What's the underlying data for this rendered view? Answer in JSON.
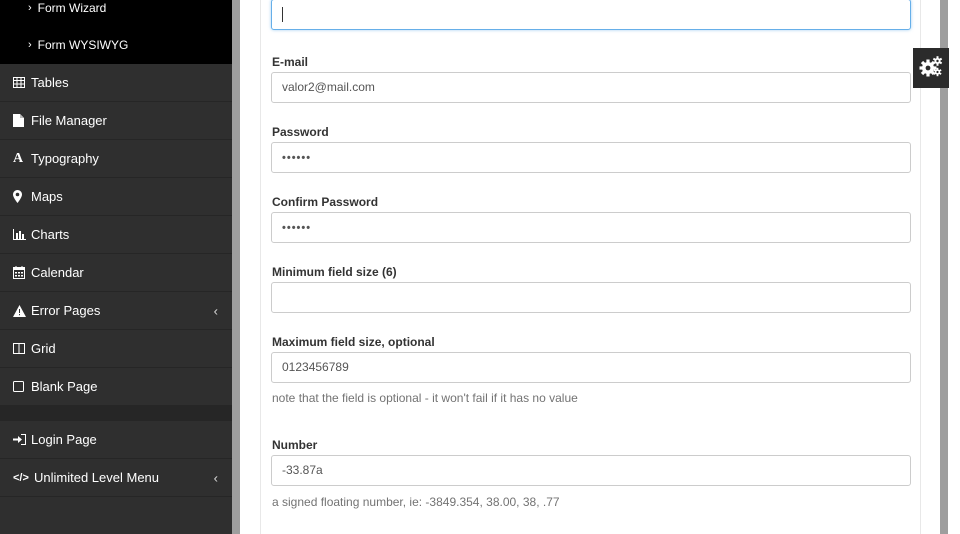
{
  "sidebar": {
    "sub_items": [
      {
        "chevron": "›",
        "label": "Form Wizard"
      },
      {
        "chevron": "›",
        "label": "Form WYSIWYG"
      }
    ],
    "items": [
      {
        "icon": "table-icon",
        "label": "Tables"
      },
      {
        "icon": "file-icon",
        "label": "File Manager"
      },
      {
        "icon": "font-icon",
        "label": "Typography"
      },
      {
        "icon": "map-marker-icon",
        "label": "Maps"
      },
      {
        "icon": "bar-chart-icon",
        "label": "Charts"
      },
      {
        "icon": "calendar-icon",
        "label": "Calendar"
      },
      {
        "icon": "warning-icon",
        "label": "Error Pages",
        "caret": "‹"
      },
      {
        "icon": "columns-icon",
        "label": "Grid"
      },
      {
        "icon": "square-icon",
        "label": "Blank Page"
      }
    ],
    "items2": [
      {
        "icon": "sign-in-icon",
        "label": "Login Page"
      },
      {
        "icon": "code-icon",
        "label": "Unlimited Level Menu",
        "caret": "‹"
      }
    ]
  },
  "form": {
    "top_field": {
      "value": ""
    },
    "email": {
      "label": "E-mail",
      "value": "valor2@mail.com"
    },
    "password": {
      "label": "Password",
      "value": "••••••"
    },
    "confirm_password": {
      "label": "Confirm Password",
      "value": "••••••"
    },
    "min_size": {
      "label": "Minimum field size (6)",
      "value": ""
    },
    "max_size": {
      "label": "Maximum field size, optional",
      "value": "0123456789",
      "help": "note that the field is optional - it won't fail if it has no value"
    },
    "number": {
      "label": "Number",
      "value": "-33.87a",
      "help": "a signed floating number, ie: -3849.354, 38.00, 38, .77"
    }
  },
  "settings": {
    "icon": "gears-icon"
  },
  "colors": {
    "sidebar_bg": "#2f2f2f",
    "submenu_bg": "#000000",
    "focus_border": "#66afe9"
  }
}
